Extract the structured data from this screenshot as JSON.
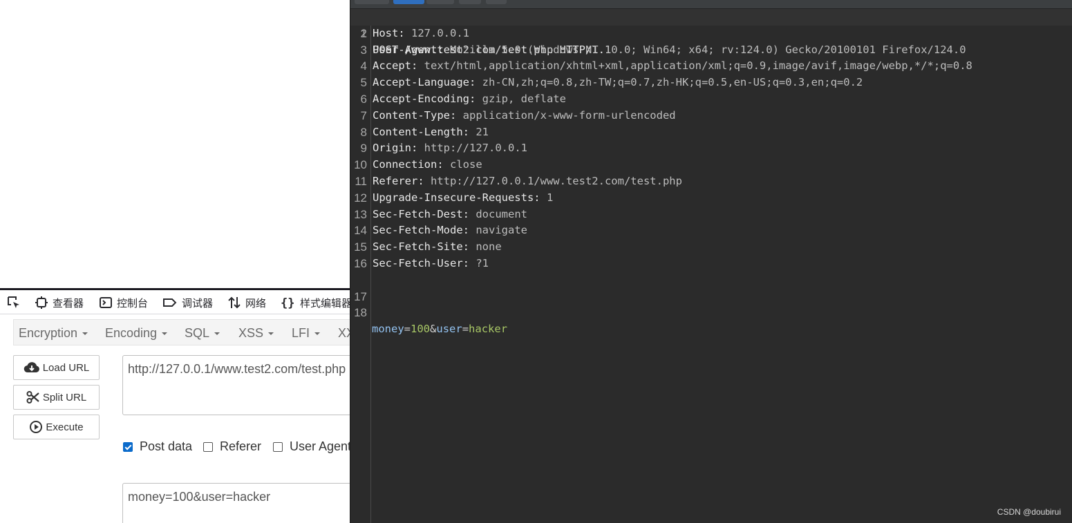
{
  "devtools": {
    "items": [
      {
        "label": "查看器",
        "icon": "inspector-icon"
      },
      {
        "label": "控制台",
        "icon": "console-icon"
      },
      {
        "label": "调试器",
        "icon": "debugger-icon"
      },
      {
        "label": "网络",
        "icon": "network-icon"
      },
      {
        "label": "样式编辑器",
        "icon": "style-editor-icon"
      }
    ]
  },
  "hackbar": {
    "menu": [
      "Encryption",
      "Encoding",
      "SQL",
      "XSS",
      "LFI",
      "XX"
    ],
    "buttons": {
      "load": "Load URL",
      "split": "Split URL",
      "execute": "Execute"
    },
    "url": "http://127.0.0.1/www.test2.com/test.php",
    "checkboxes": [
      {
        "label": "Post data",
        "checked": true
      },
      {
        "label": "Referer",
        "checked": false
      },
      {
        "label": "User Agent",
        "checked": false
      }
    ],
    "post_body": "money=100&user=hacker"
  },
  "request": {
    "request_line": "POST /www.test2.com/test.php HTTP/1.1",
    "headers": [
      {
        "n": "2",
        "key": "Host",
        "value": " 127.0.0.1"
      },
      {
        "n": "3",
        "key": "User-Agent",
        "value": " Mozilla/5.0 (Windows NT 10.0; Win64; x64; rv:124.0) Gecko/20100101 Firefox/124.0"
      },
      {
        "n": "4",
        "key": "Accept",
        "value": " text/html,application/xhtml+xml,application/xml;q=0.9,image/avif,image/webp,*/*;q=0.8"
      },
      {
        "n": "5",
        "key": "Accept-Language",
        "value": " zh-CN,zh;q=0.8,zh-TW;q=0.7,zh-HK;q=0.5,en-US;q=0.3,en;q=0.2"
      },
      {
        "n": "6",
        "key": "Accept-Encoding",
        "value": " gzip, deflate"
      },
      {
        "n": "7",
        "key": "Content-Type",
        "value": " application/x-www-form-urlencoded"
      },
      {
        "n": "8",
        "key": "Content-Length",
        "value": " 21"
      },
      {
        "n": "9",
        "key": "Origin",
        "value": " http://127.0.0.1"
      },
      {
        "n": "10",
        "key": "Connection",
        "value": " close"
      },
      {
        "n": "11",
        "key": "Referer",
        "value": " http://127.0.0.1/www.test2.com/test.php"
      },
      {
        "n": "12",
        "key": "Upgrade-Insecure-Requests",
        "value": " 1"
      },
      {
        "n": "13",
        "key": "Sec-Fetch-Dest",
        "value": " document"
      },
      {
        "n": "14",
        "key": "Sec-Fetch-Mode",
        "value": " navigate"
      },
      {
        "n": "15",
        "key": "Sec-Fetch-Site",
        "value": " none"
      },
      {
        "n": "16",
        "key": "Sec-Fetch-User",
        "value": " ?1"
      }
    ],
    "blank_line_no": "17",
    "body_line_no": "18",
    "body": [
      {
        "key": "money",
        "value": "100"
      },
      {
        "key": "user",
        "value": "hacker"
      }
    ]
  },
  "watermark": "CSDN @doubirui",
  "colors": {
    "editor_bg": "#2b2b2b",
    "param_key": "#93c2f0",
    "param_value": "#a8c766",
    "checkbox": "#0b6bcb"
  }
}
